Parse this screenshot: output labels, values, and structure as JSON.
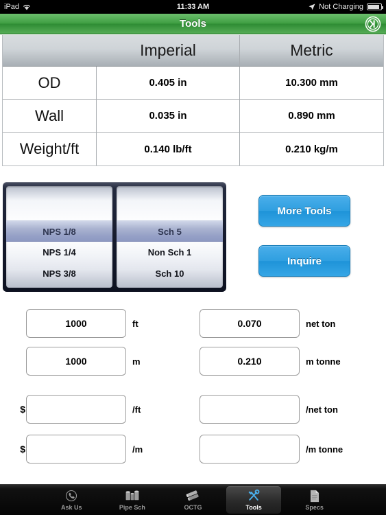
{
  "status_bar": {
    "device": "iPad",
    "wifi_icon": "wifi-icon",
    "time": "11:33 AM",
    "location_icon": "location-arrow-icon",
    "charging": "Not Charging",
    "battery_icon": "battery-icon"
  },
  "nav_bar": {
    "title": "Tools",
    "logo_label": "K",
    "logo_icon": "circle-k-logo-icon"
  },
  "spec_table": {
    "headers": [
      "",
      "Imperial",
      "Metric"
    ],
    "rows": [
      {
        "label": "OD",
        "imperial": "0.405 in",
        "metric": "10.300 mm"
      },
      {
        "label": "Wall",
        "imperial": "0.035 in",
        "metric": "0.890 mm"
      },
      {
        "label": "Weight/ft",
        "imperial": "0.140 lb/ft",
        "metric": "0.210 kg/m"
      }
    ]
  },
  "picker": {
    "nps_wheel": {
      "items": [
        "NPS 1/8",
        "NPS 1/4",
        "NPS 3/8"
      ],
      "selected": "NPS 1/8"
    },
    "sch_wheel": {
      "items": [
        "Sch 5",
        "Non Sch 1",
        "Sch 10"
      ],
      "selected": "Sch 5"
    },
    "highlight_color": "#95a0c6",
    "frame_color": "#161b2e"
  },
  "buttons": {
    "more_tools": "More Tools",
    "inquire": "Inquire",
    "accent_color": "#2f9fe0"
  },
  "calculator": {
    "left": [
      {
        "prefix": "",
        "value": "1000",
        "placeholder": "",
        "unit": "ft"
      },
      {
        "prefix": "",
        "value": "1000",
        "placeholder": "",
        "unit": "m"
      },
      {
        "prefix": "$",
        "value": "",
        "placeholder": "",
        "unit": "/ft"
      },
      {
        "prefix": "$",
        "value": "",
        "placeholder": "",
        "unit": "/m"
      }
    ],
    "right": [
      {
        "prefix": "",
        "value": "0.070",
        "placeholder": "",
        "unit": "net ton"
      },
      {
        "prefix": "",
        "value": "0.210",
        "placeholder": "",
        "unit": "m tonne"
      },
      {
        "prefix": "",
        "value": "",
        "placeholder": "",
        "unit": "/net ton"
      },
      {
        "prefix": "",
        "value": "",
        "placeholder": "",
        "unit": "/m tonne"
      }
    ]
  },
  "tab_bar": {
    "items": [
      {
        "label": "Ask Us",
        "icon": "phone-icon",
        "active": false
      },
      {
        "label": "Pipe Sch",
        "icon": "pipes-icon",
        "active": false
      },
      {
        "label": "OCTG",
        "icon": "pipe-stack-icon",
        "active": false
      },
      {
        "label": "Tools",
        "icon": "tools-icon",
        "active": true
      },
      {
        "label": "Specs",
        "icon": "document-icon",
        "active": false
      }
    ],
    "active_color": "#4ab0ee"
  }
}
